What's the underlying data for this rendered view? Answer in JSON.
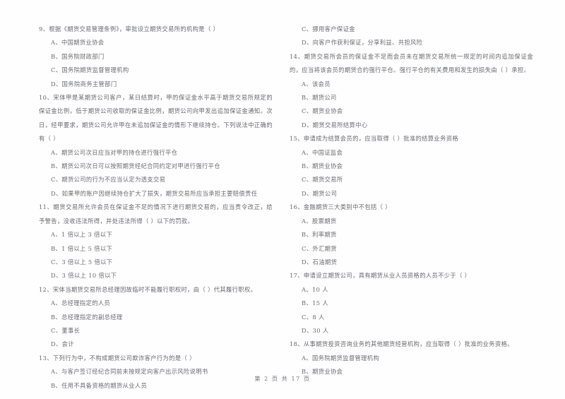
{
  "document": {
    "footer": "第 2 页 共 17 页",
    "page_number": "2",
    "total_pages": "17"
  },
  "columns": {
    "left": [
      {
        "id": "q9",
        "stem": "9、根据《期货交易管理条例》，审批设立期货交易所的机构是（      ）",
        "options": [
          "A、中国期货业协会",
          "B、国务院财政部门",
          "C、国务院期货监督管理机构",
          "D、国务院商务主管部门"
        ]
      },
      {
        "id": "q10",
        "stem": "10、宋体甲是某期货公司客户，某日结算时，甲的保证金水平高于期货交易所规定的保证金比例，低于期货公司收取的保证金比例，期货公司向甲发出追加保证金通知。次日，经甲要求，期货公司允许甲在未追加保证金的情形下继续持仓。下列说法中正确的有（      ）",
        "options": [
          "A、期货公司次日应当对甲的持仓进行强行平仓",
          "B、期货公司次日可以按照期货经纪合同约定对甲进行强行平仓",
          "C、期货公司的行为不应当认定为透支交易",
          "D、如果甲的账户因继续持仓扩大了损失，期货交易所应当承担主要赔偿责任"
        ]
      },
      {
        "id": "q11",
        "stem": "11、期货交易所允许会员在保证金不足的情况下进行期货交易的，应当责令改正，给予警告，没收违法所得，并处违法所得（      ）以下的罚款。",
        "options": [
          "A、1 倍以上 3 倍以下",
          "B、1 倍以上 5 倍以下",
          "C、3 倍以上 5 倍以下",
          "D、3 倍以上 10 倍以下"
        ]
      },
      {
        "id": "q12",
        "stem": "12、宋体当期货交易所总经理因故临时不能履行职权时，由（      ）代其履行职权。",
        "options": [
          "A、总经理指定的人员",
          "B、总经理指定的副总经理",
          "C、董事长",
          "D、会计"
        ]
      },
      {
        "id": "q13",
        "stem": "13、下列行为中，不构成期货公司欺诈客户行为的是（      ）",
        "options": [
          "A、与客户签订经纪合同前未按规定向客户出示风险说明书",
          "B、任用不具备资格的期货从业人员"
        ]
      }
    ],
    "right": [
      {
        "id": "q9cont",
        "stem": "",
        "options": [
          "C、挪用客户保证金",
          "D、向客户作获利保证，分享利益、共担风险"
        ]
      },
      {
        "id": "q14",
        "stem": "14、期货交易所会员的保证金不足而会员未在期货交易所统一规定的时间内追加保证金的，应当将该会员的期货合约强行平仓。强行平仓的有关费用和发生的损失由（      ）承担。",
        "options": [
          "A、该会员",
          "B、期货公司",
          "C、期货业协会",
          "D、期货交易所结算中心"
        ]
      },
      {
        "id": "q15",
        "stem": "15、申请成为结算会员的，应当取得（      ）批准的结算业务资格",
        "options": [
          "A、中国证监会",
          "B、期货业协会",
          "C、期货交易所",
          "D、期货公司"
        ]
      },
      {
        "id": "q16",
        "stem": "16、金融期货三大类别中不包括（      ）",
        "options": [
          "A、股票期货",
          "B、利率期货",
          "C、外汇期货",
          "D、石油期货"
        ]
      },
      {
        "id": "q17",
        "stem": "17、申请设立期货公司，具有期货从业人员资格的人员不少于（      ）",
        "options": [
          "A、10 人",
          "B、15 人",
          "C、8 人",
          "D、30 人"
        ]
      },
      {
        "id": "q18",
        "stem": "18、从事期货投资咨询业务的其他期货经营机构，应当取得（      ）批准的业务资格。",
        "options": [
          "A、国务院期货监督管理机构",
          "B、期货业协会"
        ]
      }
    ]
  }
}
